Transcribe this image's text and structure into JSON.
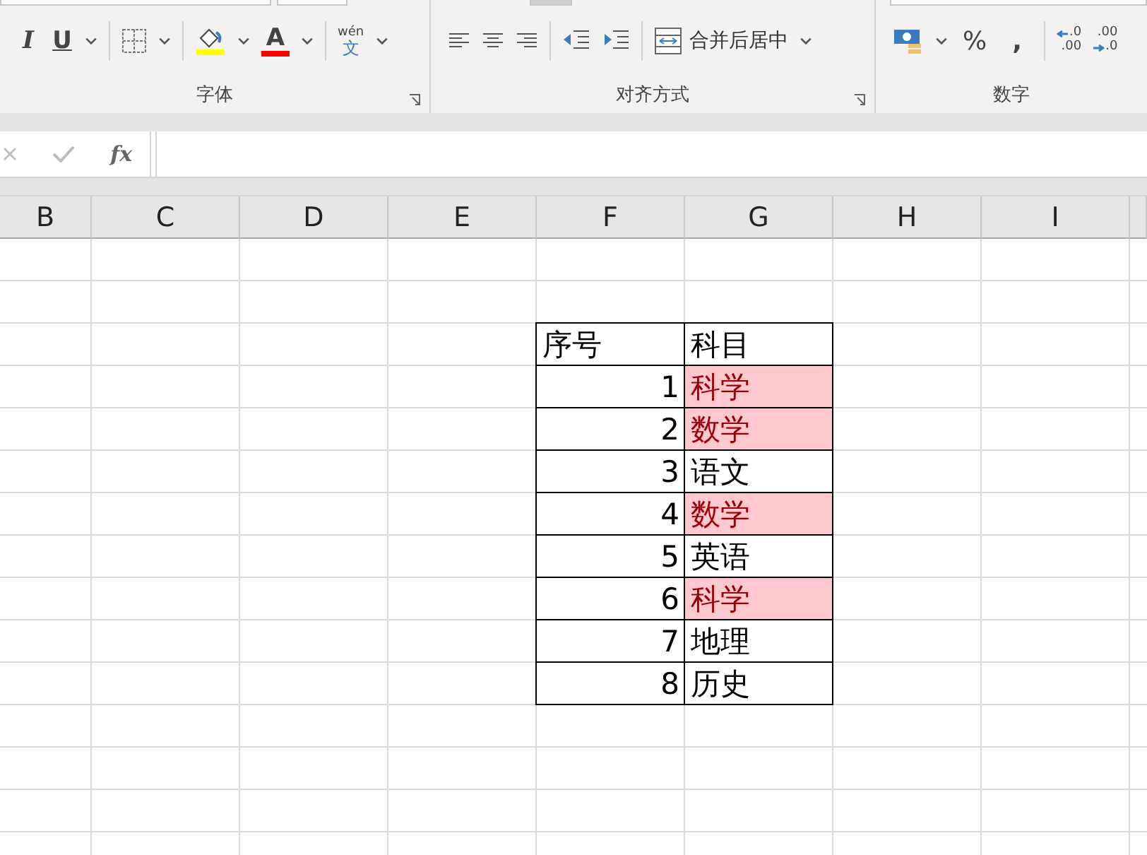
{
  "ribbon": {
    "font_group": {
      "italic": "I",
      "underline": "U",
      "font_color": "A",
      "phonetic_top": "wén",
      "phonetic_bottom": "文",
      "label": "字体"
    },
    "align_group": {
      "merge_button": "合并后居中",
      "label": "对齐方式"
    },
    "number_group": {
      "percent": "%",
      "comma": ",",
      "increase_decimal": [
        ".0",
        ".00"
      ],
      "decrease_decimal": [
        ".00",
        ".0"
      ],
      "label": "数字"
    }
  },
  "formula_bar": {
    "fx": "fx"
  },
  "column_headers": [
    "B",
    "C",
    "D",
    "E",
    "F",
    "G",
    "H",
    "I"
  ],
  "table": {
    "columns": [
      "序号",
      "科目"
    ],
    "rows": [
      {
        "cells": [
          "1",
          "科学"
        ],
        "highlighted": true
      },
      {
        "cells": [
          "2",
          "数学"
        ],
        "highlighted": true
      },
      {
        "cells": [
          "3",
          "语文"
        ],
        "highlighted": false
      },
      {
        "cells": [
          "4",
          "数学"
        ],
        "highlighted": true
      },
      {
        "cells": [
          "5",
          "英语"
        ],
        "highlighted": false
      },
      {
        "cells": [
          "6",
          "科学"
        ],
        "highlighted": true
      },
      {
        "cells": [
          "7",
          "地理"
        ],
        "highlighted": false
      },
      {
        "cells": [
          "8",
          "历史"
        ],
        "highlighted": false
      }
    ]
  }
}
